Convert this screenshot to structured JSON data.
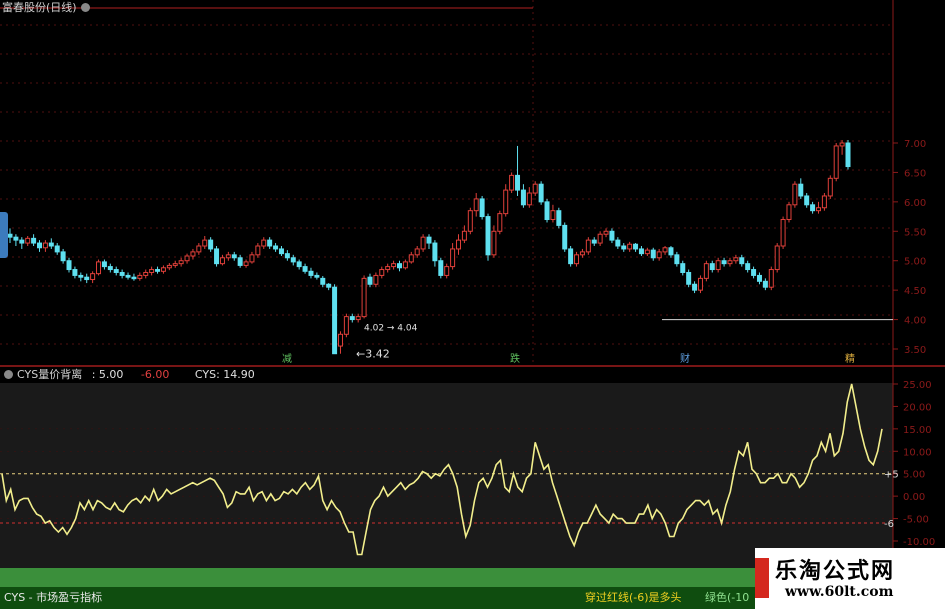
{
  "window": {
    "title": "富春股份(日线)"
  },
  "price_panel": {
    "axis_ticks": [
      "7.00",
      "6.50",
      "6.00",
      "5.50",
      "5.00",
      "4.50",
      "4.00",
      "3.50"
    ],
    "low_label": "←3.42",
    "low_value": 3.42,
    "overlay_text": "4.02 → 4.04",
    "event_tags": [
      "减",
      "跌",
      "财",
      "精"
    ]
  },
  "indicator_header": {
    "name": "CYS量价背离",
    "v1": ": 5.00",
    "v2": "-6.00",
    "v3": "CYS: 14.90"
  },
  "indicator_panel": {
    "axis_ticks": [
      "25.00",
      "20.00",
      "15.00",
      "10.00",
      "5.00",
      "0.00",
      "-5.00",
      "-10.00"
    ],
    "upper_line_label": "+5",
    "lower_line_label": "-6",
    "upper_line": 5,
    "lower_line": -6
  },
  "footer": {
    "left": "CYS - 市场盈亏指标",
    "right": "穿过红线(-6)是多头",
    "right2": "绿色(-10"
  },
  "watermark": {
    "title": "乐淘公式网",
    "url": "www.60lt.com"
  },
  "colors": {
    "up": "#e0403a",
    "down": "#5fe0f0",
    "cys_line": "#f2ee8c",
    "axis_red": "#8c1a1a",
    "grid": "#6a1414"
  },
  "chart_data": [
    {
      "type": "candlestick",
      "ylim": [
        3.3,
        7.05
      ],
      "candles": [
        [
          5.45,
          5.4,
          5.55,
          5.3
        ],
        [
          5.4,
          5.35,
          5.45,
          5.25
        ],
        [
          5.35,
          5.3,
          5.4,
          5.2
        ],
        [
          5.3,
          5.38,
          5.42,
          5.25
        ],
        [
          5.38,
          5.3,
          5.45,
          5.25
        ],
        [
          5.3,
          5.22,
          5.35,
          5.15
        ],
        [
          5.22,
          5.3,
          5.35,
          5.15
        ],
        [
          5.3,
          5.25,
          5.38,
          5.2
        ],
        [
          5.25,
          5.15,
          5.3,
          5.1
        ],
        [
          5.15,
          5.0,
          5.2,
          4.95
        ],
        [
          5.0,
          4.85,
          5.05,
          4.8
        ],
        [
          4.85,
          4.75,
          4.9,
          4.7
        ],
        [
          4.75,
          4.72,
          4.8,
          4.65
        ],
        [
          4.72,
          4.68,
          4.78,
          4.62
        ],
        [
          4.68,
          4.78,
          4.82,
          4.62
        ],
        [
          4.78,
          4.98,
          5.02,
          4.75
        ],
        [
          4.98,
          4.9,
          5.02,
          4.85
        ],
        [
          4.9,
          4.85,
          4.95,
          4.8
        ],
        [
          4.85,
          4.8,
          4.9,
          4.75
        ],
        [
          4.8,
          4.75,
          4.85,
          4.7
        ],
        [
          4.75,
          4.72,
          4.8,
          4.68
        ],
        [
          4.72,
          4.7,
          4.78,
          4.66
        ],
        [
          4.7,
          4.75,
          4.8,
          4.66
        ],
        [
          4.75,
          4.8,
          4.85,
          4.7
        ],
        [
          4.8,
          4.85,
          4.9,
          4.75
        ],
        [
          4.85,
          4.82,
          4.9,
          4.78
        ],
        [
          4.82,
          4.88,
          4.92,
          4.78
        ],
        [
          4.88,
          4.92,
          4.96,
          4.84
        ],
        [
          4.92,
          4.95,
          5.0,
          4.88
        ],
        [
          4.95,
          5.0,
          5.05,
          4.9
        ],
        [
          5.0,
          5.08,
          5.12,
          4.95
        ],
        [
          5.08,
          5.15,
          5.2,
          5.02
        ],
        [
          5.15,
          5.25,
          5.3,
          5.1
        ],
        [
          5.25,
          5.35,
          5.42,
          5.2
        ],
        [
          5.35,
          5.2,
          5.4,
          5.15
        ],
        [
          5.2,
          4.95,
          5.25,
          4.9
        ],
        [
          4.95,
          5.05,
          5.1,
          4.92
        ],
        [
          5.05,
          5.1,
          5.15,
          5.0
        ],
        [
          5.1,
          5.05,
          5.15,
          5.0
        ],
        [
          5.05,
          4.92,
          5.1,
          4.88
        ],
        [
          4.92,
          4.98,
          5.02,
          4.88
        ],
        [
          4.98,
          5.1,
          5.15,
          4.95
        ],
        [
          5.1,
          5.25,
          5.3,
          5.05
        ],
        [
          5.25,
          5.35,
          5.4,
          5.2
        ],
        [
          5.35,
          5.25,
          5.4,
          5.2
        ],
        [
          5.25,
          5.2,
          5.3,
          5.15
        ],
        [
          5.2,
          5.12,
          5.25,
          5.08
        ],
        [
          5.12,
          5.05,
          5.18,
          5.0
        ],
        [
          5.05,
          4.98,
          5.1,
          4.92
        ],
        [
          4.98,
          4.9,
          5.02,
          4.85
        ],
        [
          4.9,
          4.82,
          4.95,
          4.78
        ],
        [
          4.82,
          4.75,
          4.88,
          4.7
        ],
        [
          4.75,
          4.72,
          4.8,
          4.68
        ],
        [
          4.7,
          4.6,
          4.74,
          4.55
        ],
        [
          4.6,
          4.55,
          4.62,
          4.5
        ],
        [
          4.55,
          3.42,
          4.6,
          3.42
        ],
        [
          3.55,
          3.75,
          3.8,
          3.42
        ],
        [
          3.75,
          4.05,
          4.1,
          3.7
        ],
        [
          4.05,
          4.0,
          4.1,
          3.95
        ],
        [
          4.0,
          4.05,
          4.1,
          3.95
        ],
        [
          4.05,
          4.7,
          4.75,
          4.02
        ],
        [
          4.72,
          4.6,
          4.78,
          4.55
        ],
        [
          4.6,
          4.75,
          4.8,
          4.55
        ],
        [
          4.75,
          4.85,
          4.9,
          4.7
        ],
        [
          4.85,
          4.9,
          4.95,
          4.8
        ],
        [
          4.9,
          4.95,
          5.0,
          4.85
        ],
        [
          4.95,
          4.88,
          5.0,
          4.82
        ],
        [
          4.88,
          4.98,
          5.02,
          4.85
        ],
        [
          4.98,
          5.1,
          5.15,
          4.95
        ],
        [
          5.1,
          5.2,
          5.25,
          5.05
        ],
        [
          5.2,
          5.4,
          5.45,
          5.15
        ],
        [
          5.4,
          5.3,
          5.45,
          5.2
        ],
        [
          5.3,
          5.0,
          5.35,
          4.9
        ],
        [
          5.0,
          4.75,
          5.05,
          4.7
        ],
        [
          4.75,
          4.9,
          4.95,
          4.7
        ],
        [
          4.9,
          5.2,
          5.3,
          4.85
        ],
        [
          5.2,
          5.35,
          5.45,
          5.1
        ],
        [
          5.35,
          5.5,
          5.6,
          5.3
        ],
        [
          5.5,
          5.85,
          5.9,
          5.45
        ],
        [
          5.85,
          6.05,
          6.15,
          5.75
        ],
        [
          6.05,
          5.75,
          6.1,
          5.7
        ],
        [
          5.75,
          5.1,
          5.8,
          5.0
        ],
        [
          5.1,
          5.5,
          5.6,
          5.05
        ],
        [
          5.5,
          5.8,
          5.85,
          5.45
        ],
        [
          5.8,
          6.2,
          6.3,
          5.75
        ],
        [
          6.2,
          6.45,
          6.5,
          6.15
        ],
        [
          6.45,
          6.2,
          6.95,
          6.1
        ],
        [
          6.2,
          5.95,
          6.3,
          5.9
        ],
        [
          5.95,
          6.15,
          6.25,
          5.9
        ],
        [
          6.15,
          6.3,
          6.35,
          6.1
        ],
        [
          6.3,
          6.0,
          6.35,
          5.95
        ],
        [
          6.0,
          5.7,
          6.05,
          5.65
        ],
        [
          5.7,
          5.85,
          5.95,
          5.65
        ],
        [
          5.85,
          5.6,
          5.9,
          5.55
        ],
        [
          5.6,
          5.2,
          5.65,
          5.15
        ],
        [
          5.2,
          4.95,
          5.25,
          4.9
        ],
        [
          4.95,
          5.1,
          5.15,
          4.9
        ],
        [
          5.1,
          5.15,
          5.2,
          5.05
        ],
        [
          5.15,
          5.35,
          5.4,
          5.1
        ],
        [
          5.35,
          5.3,
          5.4,
          5.25
        ],
        [
          5.3,
          5.45,
          5.5,
          5.25
        ],
        [
          5.45,
          5.5,
          5.55,
          5.4
        ],
        [
          5.5,
          5.35,
          5.55,
          5.3
        ],
        [
          5.35,
          5.25,
          5.4,
          5.2
        ],
        [
          5.25,
          5.2,
          5.3,
          5.15
        ],
        [
          5.2,
          5.28,
          5.32,
          5.15
        ],
        [
          5.28,
          5.2,
          5.3,
          5.15
        ],
        [
          5.2,
          5.12,
          5.25,
          5.08
        ],
        [
          5.12,
          5.18,
          5.22,
          5.08
        ],
        [
          5.18,
          5.05,
          5.22,
          5.0
        ],
        [
          5.05,
          5.15,
          5.2,
          5.0
        ],
        [
          5.15,
          5.22,
          5.25,
          5.1
        ],
        [
          5.22,
          5.1,
          5.25,
          5.05
        ],
        [
          5.1,
          4.95,
          5.15,
          4.9
        ],
        [
          4.95,
          4.8,
          5.0,
          4.75
        ],
        [
          4.8,
          4.6,
          4.85,
          4.55
        ],
        [
          4.6,
          4.5,
          4.65,
          4.45
        ],
        [
          4.5,
          4.7,
          4.75,
          4.45
        ],
        [
          4.7,
          4.95,
          5.0,
          4.65
        ],
        [
          4.95,
          4.85,
          5.0,
          4.8
        ],
        [
          4.85,
          5.0,
          5.05,
          4.8
        ],
        [
          5.0,
          4.95,
          5.05,
          4.9
        ],
        [
          4.95,
          5.0,
          5.05,
          4.9
        ],
        [
          5.0,
          5.05,
          5.1,
          4.95
        ],
        [
          5.05,
          4.95,
          5.1,
          4.9
        ],
        [
          4.95,
          4.85,
          5.0,
          4.8
        ],
        [
          4.85,
          4.75,
          4.9,
          4.7
        ],
        [
          4.75,
          4.65,
          4.8,
          4.6
        ],
        [
          4.65,
          4.55,
          4.7,
          4.5
        ],
        [
          4.55,
          4.85,
          4.9,
          4.5
        ],
        [
          4.85,
          5.25,
          5.3,
          4.8
        ],
        [
          5.25,
          5.7,
          5.75,
          5.2
        ],
        [
          5.7,
          5.95,
          6.0,
          5.65
        ],
        [
          5.95,
          6.3,
          6.35,
          5.9
        ],
        [
          6.3,
          6.1,
          6.4,
          6.05
        ],
        [
          6.1,
          5.95,
          6.15,
          5.9
        ],
        [
          5.95,
          5.85,
          6.0,
          5.8
        ],
        [
          5.85,
          5.9,
          6.0,
          5.8
        ],
        [
          5.9,
          6.1,
          6.15,
          5.85
        ],
        [
          6.1,
          6.4,
          6.45,
          6.05
        ],
        [
          6.4,
          6.95,
          7.0,
          6.35
        ],
        [
          6.95,
          7.0,
          7.05,
          6.8
        ],
        [
          7.0,
          6.6,
          7.05,
          6.55
        ]
      ],
      "support_line": 4.0
    },
    {
      "type": "line",
      "title": "CYS量价背离",
      "ylim": [
        -12,
        26
      ],
      "series": [
        {
          "name": "CYS",
          "values": [
            5,
            -1,
            1.5,
            -3,
            -1,
            -0.5,
            -0.5,
            -2.5,
            -4,
            -4.5,
            -6,
            -5.5,
            -7,
            -8,
            -7,
            -8.5,
            -7,
            -5,
            -1.5,
            -3,
            -1,
            -3,
            -1,
            -1.5,
            -2.5,
            -3,
            -1.5,
            -3,
            -3.5,
            -2,
            -1,
            -0.5,
            -1.5,
            0,
            -1,
            1.5,
            -1,
            0,
            1.5,
            0.5,
            1,
            1.5,
            2,
            2.5,
            3,
            2.5,
            3,
            3.5,
            4,
            3.5,
            2,
            0.5,
            -2.5,
            -1.5,
            1,
            0.5,
            0.5,
            2,
            -1,
            0.5,
            1,
            -1,
            0.5,
            -1,
            -0.5,
            1,
            0.5,
            1.5,
            0.5,
            2,
            3,
            1.5,
            2.5,
            4.5,
            -1,
            -3,
            -1,
            -2.5,
            -3.5,
            -6,
            -8,
            -8,
            -13,
            -13,
            -8,
            -3,
            -1,
            0,
            2,
            0,
            1,
            2,
            3,
            1.5,
            2.5,
            3,
            4,
            5.5,
            5,
            4,
            5,
            4.5,
            6,
            7,
            5,
            2,
            -4,
            -9,
            -6.5,
            -1,
            3,
            4,
            2,
            4,
            7,
            8,
            2,
            1,
            5,
            2,
            1,
            4,
            5,
            12,
            9,
            6,
            7,
            3,
            0,
            -3,
            -6,
            -9,
            -11,
            -8,
            -6,
            -6,
            -4,
            -2,
            -4,
            -5,
            -6,
            -4,
            -5,
            -5,
            -6,
            -6,
            -6,
            -4,
            -4,
            -2,
            -5,
            -3,
            -4,
            -6,
            -9,
            -9,
            -6,
            -5,
            -3,
            -2,
            -1,
            -1,
            -2,
            -1,
            -4,
            -3,
            -6,
            -2,
            1,
            6,
            10,
            9,
            12,
            6,
            5,
            3,
            3,
            4,
            4,
            5,
            3,
            3,
            5,
            4,
            2,
            3,
            5,
            8,
            9,
            12,
            10,
            14,
            9,
            10,
            14,
            21,
            25,
            20,
            15,
            11,
            8,
            7,
            10,
            15
          ]
        }
      ]
    }
  ]
}
